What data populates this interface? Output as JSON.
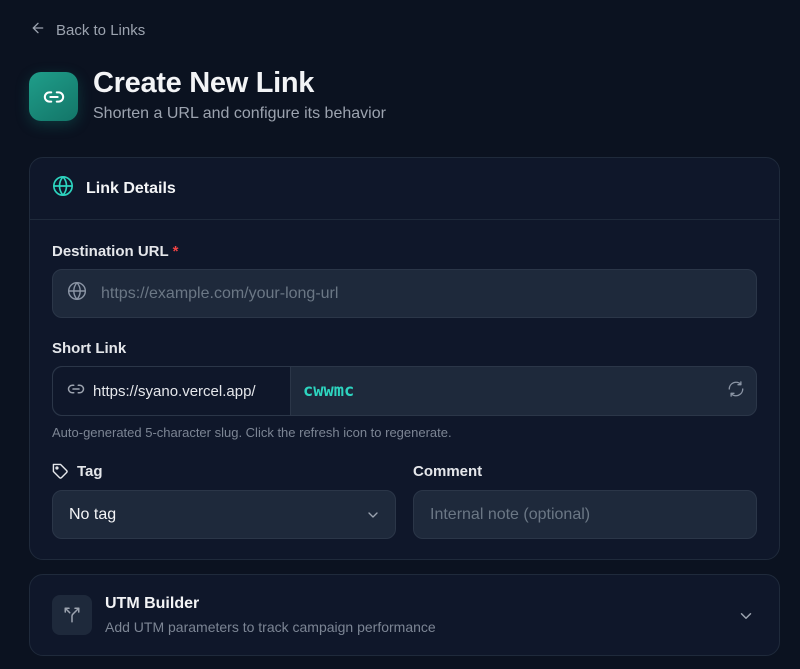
{
  "nav": {
    "back_label": "Back to Links"
  },
  "header": {
    "title": "Create New Link",
    "subtitle": "Shorten a URL and configure its behavior"
  },
  "link_details": {
    "section_title": "Link Details",
    "destination": {
      "label": "Destination URL",
      "required_mark": "*",
      "placeholder": "https://example.com/your-long-url",
      "value": ""
    },
    "short_link": {
      "label": "Short Link",
      "prefix": "https://syano.vercel.app/",
      "slug": "cwwmc",
      "help": "Auto-generated 5-character slug. Click the refresh icon to regenerate."
    },
    "tag": {
      "label": "Tag",
      "selected": "No tag"
    },
    "comment": {
      "label": "Comment",
      "placeholder": "Internal note (optional)",
      "value": ""
    }
  },
  "utm_builder": {
    "title": "UTM Builder",
    "description": "Add UTM parameters to track campaign performance"
  },
  "colors": {
    "background": "#0b1220",
    "card": "#0f172a",
    "input": "#1e293b",
    "accent": "#2dd4bf",
    "brand_icon": "#1f9e8a",
    "required": "#ef4444"
  },
  "icons": {
    "back": "arrow-left-icon",
    "header": "link-icon",
    "section": "globe-icon",
    "destination": "globe-icon",
    "short_link": "link-icon",
    "refresh": "refresh-icon",
    "tag": "tag-icon",
    "select": "chevron-down-icon",
    "utm": "split-icon",
    "utm_toggle": "chevron-down-icon"
  }
}
